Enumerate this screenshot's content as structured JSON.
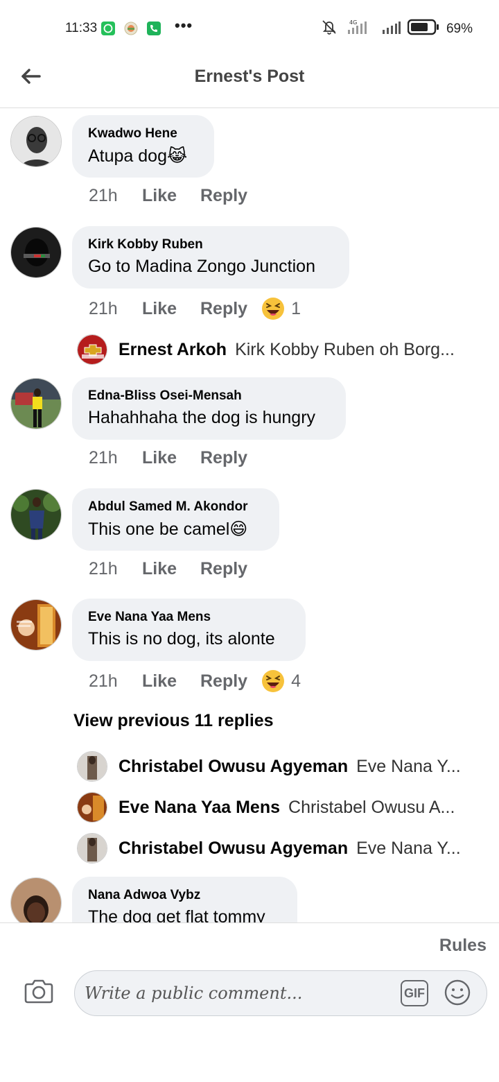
{
  "status_bar": {
    "time": "11:33",
    "more": "•••",
    "battery": "69%",
    "network": "4G"
  },
  "header": {
    "title": "Ernest's Post"
  },
  "comments": [
    {
      "name": "Kwadwo Hene",
      "text": "Atupa dog😹",
      "time": "21h",
      "like": "Like",
      "reply": "Reply"
    },
    {
      "name": "Kirk Kobby Ruben",
      "text": "Go to Madina Zongo Junction",
      "time": "21h",
      "like": "Like",
      "reply": "Reply",
      "reaction_count": "1",
      "replies": [
        {
          "name": "Ernest Arkoh",
          "text": "Kirk Kobby Ruben oh Borg..."
        }
      ]
    },
    {
      "name": "Edna-Bliss Osei-Mensah",
      "text": "Hahahhaha the dog is hungry",
      "time": "21h",
      "like": "Like",
      "reply": "Reply"
    },
    {
      "name": "Abdul Samed M. Akondor",
      "text": "This one be camel😄",
      "time": "21h",
      "like": "Like",
      "reply": "Reply"
    },
    {
      "name": "Eve Nana Yaa Mens",
      "text": "This is no dog, its alonte",
      "time": "21h",
      "like": "Like",
      "reply": "Reply",
      "reaction_count": "4",
      "view_previous": "View previous 11 replies",
      "replies": [
        {
          "name": "Christabel Owusu Agyeman",
          "text": "Eve Nana Y..."
        },
        {
          "name": "Eve Nana Yaa Mens",
          "text": "Christabel Owusu A..."
        },
        {
          "name": "Christabel Owusu Agyeman",
          "text": "Eve Nana Y..."
        }
      ]
    },
    {
      "name": "Nana Adwoa Vybz",
      "text": "The dog get flat tommy"
    }
  ],
  "footer": {
    "rules": "Rules",
    "placeholder": "Write a public comment...",
    "gif_label": "GIF"
  }
}
